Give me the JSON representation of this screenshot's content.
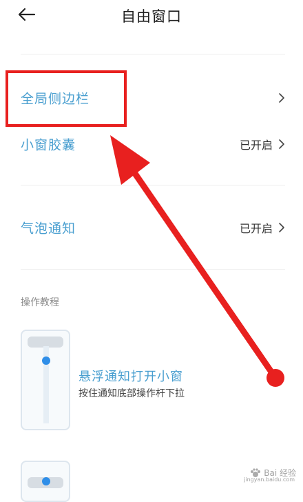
{
  "header": {
    "title": "自由窗口",
    "back_icon": "arrow-left-icon"
  },
  "settings": [
    {
      "label": "全局侧边栏",
      "status": "",
      "icon": "chevron-right-icon"
    },
    {
      "label": "小窗胶囊",
      "status": "已开启",
      "icon": "chevron-right-icon"
    },
    {
      "label": "气泡通知",
      "status": "已开启",
      "icon": "chevron-right-icon"
    }
  ],
  "tutorial": {
    "section_label": "操作教程",
    "items": [
      {
        "title": "悬浮通知打开小窗",
        "description": "按住通知底部操作杆下拉"
      }
    ]
  },
  "annotation": {
    "color": "#e8201f",
    "target": "全局侧边栏"
  },
  "watermark": {
    "text": "Bai 经验",
    "sub": "jingyan.baidu.com"
  },
  "colors": {
    "accent": "#4a9fd0",
    "annotation_red": "#e8201f",
    "divider": "#eeeeee"
  }
}
